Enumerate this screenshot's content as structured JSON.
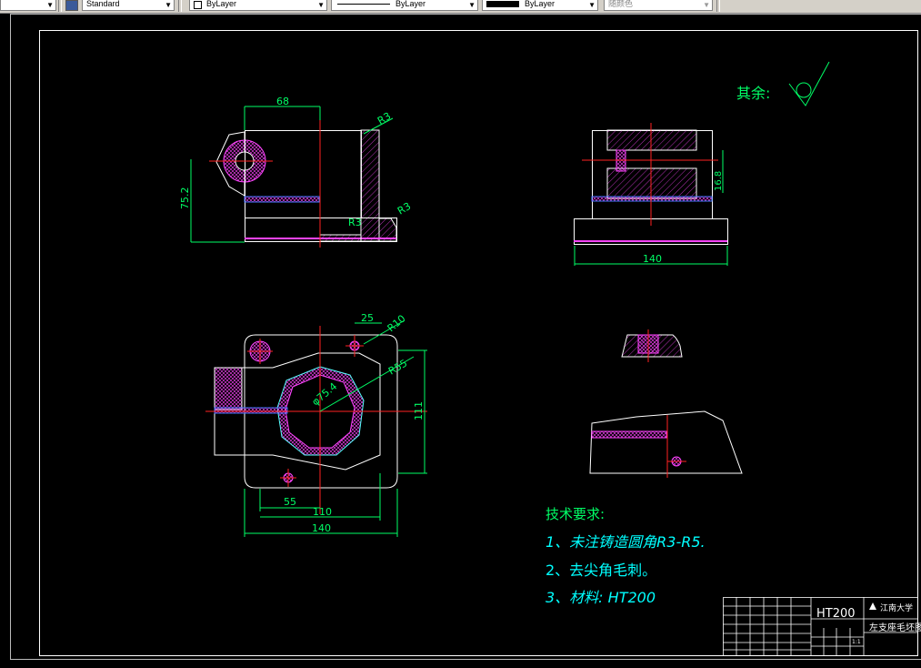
{
  "toolbar": {
    "textstyle": "Standard",
    "layer": "ByLayer",
    "linetype": "ByLayer",
    "lineweight": "ByLayer",
    "plotstyle": "随颜色"
  },
  "drawing": {
    "roughness_label": "其余:",
    "dims": {
      "front_width": "68",
      "front_height": "75.2",
      "radius_r3": "R3",
      "side_width": "140",
      "side_height": "16.8",
      "top_25": "25",
      "top_r10": "R10",
      "top_r55": "R55",
      "top_phi": "φ75.4",
      "top_55": "55",
      "top_110": "110",
      "top_140": "140",
      "top_111": "111"
    },
    "requirements": {
      "title": "技术要求:",
      "items": [
        "1、未注铸造圆角R3-R5.",
        "2、去尖角毛刺。",
        "3、材料: HT200"
      ]
    }
  },
  "title_block": {
    "material": "HT200",
    "school": "江南大学",
    "drawing_name": "左支座毛坯图",
    "scale": "1:1"
  }
}
